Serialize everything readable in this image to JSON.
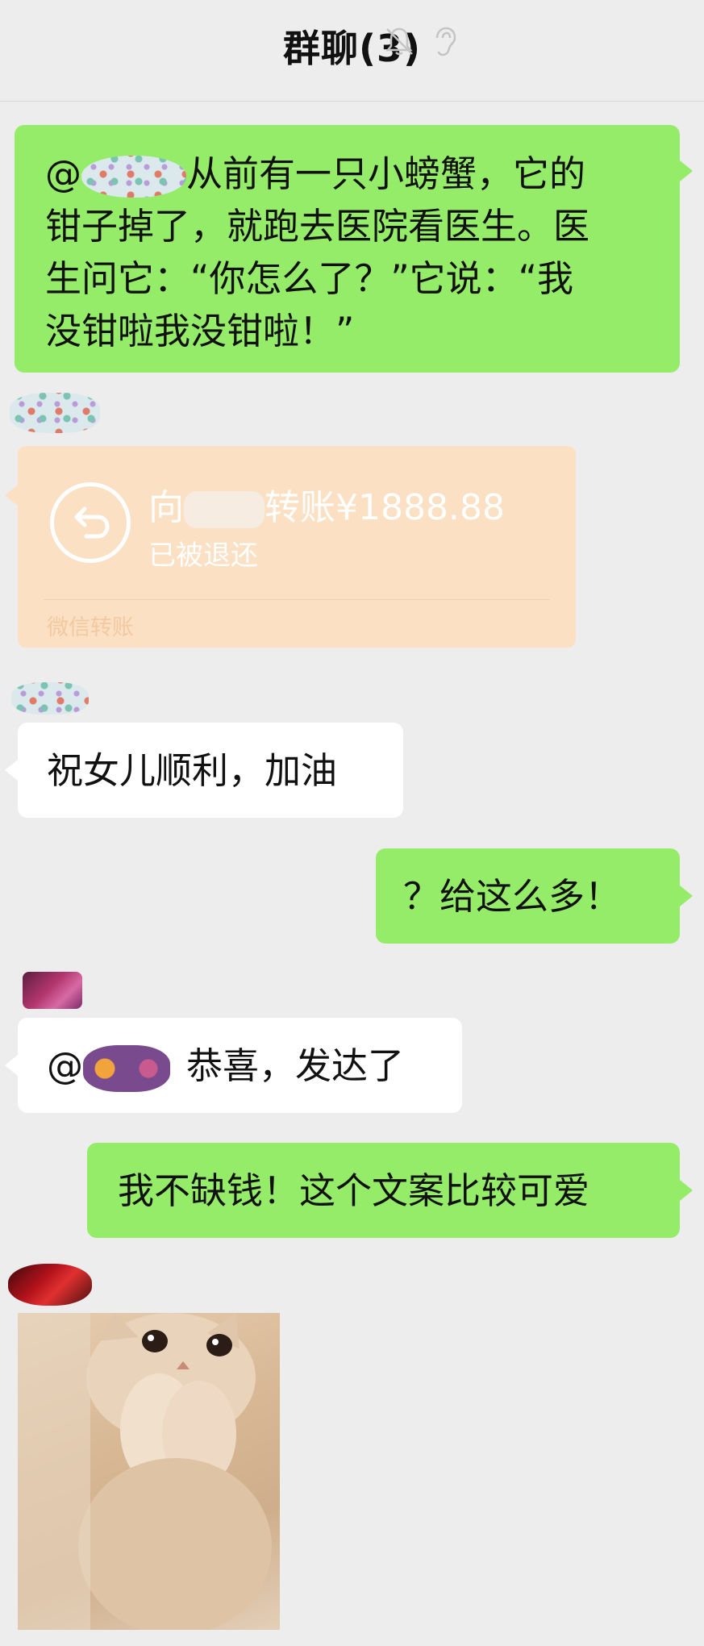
{
  "header": {
    "title": "群聊(3)",
    "icons": [
      "mute-bell-icon",
      "ear-icon"
    ]
  },
  "messages": [
    {
      "type": "text",
      "side": "right",
      "at_symbol": "@",
      "lines": [
        "从前有一只小螃蟹，它的",
        "钳子掉了，就跑去医院看医生。医",
        "生问它：“你怎么了？”它说：“我",
        "没钳啦我没钳啦！”"
      ]
    },
    {
      "type": "transfer",
      "side": "left",
      "title_prefix": "向",
      "title_suffix": "转账¥1888.88",
      "status": "已被退还",
      "footer": "微信转账",
      "icon": "return-arrow-icon"
    },
    {
      "type": "text",
      "side": "left",
      "text": "祝女儿顺利，加油"
    },
    {
      "type": "text",
      "side": "right",
      "text": "？给这么多！"
    },
    {
      "type": "text",
      "side": "left",
      "at_symbol": "@",
      "text": "恭喜，发达了"
    },
    {
      "type": "text",
      "side": "right",
      "text": "我不缺钱！这个文案比较可爱"
    },
    {
      "type": "image",
      "side": "left",
      "subject": "kitten-photo"
    }
  ],
  "colors": {
    "background": "#ededed",
    "self_bubble": "#95ec69",
    "other_bubble": "#ffffff",
    "transfer_card": "#fbe0c4"
  }
}
